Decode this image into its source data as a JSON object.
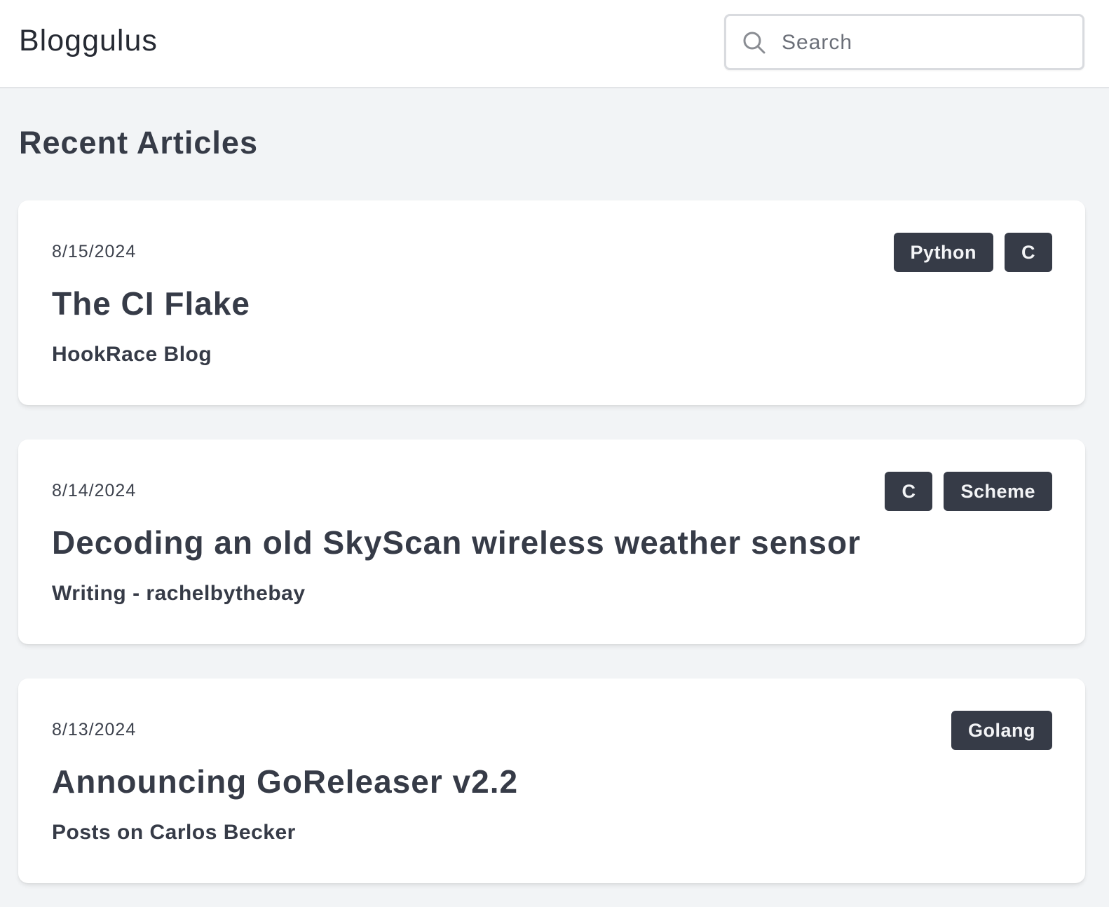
{
  "header": {
    "brand": "Bloggulus",
    "search": {
      "placeholder": "Search",
      "value": "",
      "icon": "search-icon"
    }
  },
  "main": {
    "section_title": "Recent Articles",
    "articles": [
      {
        "date": "8/15/2024",
        "title": "The CI Flake",
        "source": "HookRace Blog",
        "tags": [
          "Python",
          "C"
        ]
      },
      {
        "date": "8/14/2024",
        "title": "Decoding an old SkyScan wireless weather sensor",
        "source": "Writing - rachelbythebay",
        "tags": [
          "C",
          "Scheme"
        ]
      },
      {
        "date": "8/13/2024",
        "title": "Announcing GoReleaser v2.2",
        "source": "Posts on Carlos Becker",
        "tags": [
          "Golang"
        ]
      }
    ]
  },
  "colors": {
    "background": "#f2f4f6",
    "card": "#ffffff",
    "text": "#363b47",
    "tag_bg": "#363b47",
    "tag_text": "#f3f4f6"
  }
}
